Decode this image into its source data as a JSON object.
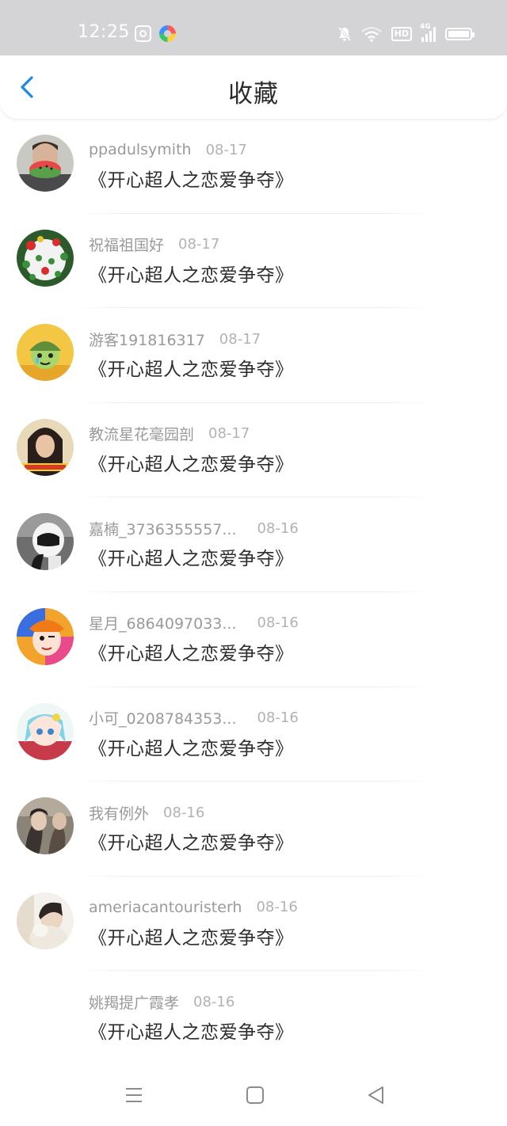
{
  "status_bar": {
    "time": "12:25",
    "signal_label": "4G",
    "hd_label": "HD",
    "icons": [
      "app-icon-1",
      "app-icon-2",
      "mute-bell-icon",
      "wifi-icon",
      "hd-icon",
      "signal-icon",
      "battery-icon"
    ]
  },
  "header": {
    "title": "收藏",
    "back_icon": "chevron-left-icon"
  },
  "favorites": [
    {
      "user": "ppadulsymith",
      "date": "08-17",
      "title": "《开心超人之恋爱争夺》"
    },
    {
      "user": "祝福祖国好",
      "date": "08-17",
      "title": "《开心超人之恋爱争夺》"
    },
    {
      "user": "游客191816317",
      "date": "08-17",
      "title": "《开心超人之恋爱争夺》"
    },
    {
      "user": "教流星花毫园剖",
      "date": "08-17",
      "title": "《开心超人之恋爱争夺》"
    },
    {
      "user": "嘉楠_3736355557...",
      "date": "08-16",
      "title": "《开心超人之恋爱争夺》"
    },
    {
      "user": "星月_6864097033...",
      "date": "08-16",
      "title": "《开心超人之恋爱争夺》"
    },
    {
      "user": "小可_0208784353...",
      "date": "08-16",
      "title": "《开心超人之恋爱争夺》"
    },
    {
      "user": "我有例外",
      "date": "08-16",
      "title": "《开心超人之恋爱争夺》"
    },
    {
      "user": "ameriacantouristerh",
      "date": "08-16",
      "title": "《开心超人之恋爱争夺》"
    },
    {
      "user": "姚羯提广霞孝",
      "date": "08-16",
      "title": "《开心超人之恋爱争夺》"
    }
  ],
  "nav_bar": {
    "icons": [
      "menu-icon",
      "home-square-icon",
      "back-triangle-icon"
    ]
  },
  "colors": {
    "status_bar_bg": "#d4d4d6",
    "accent_blue": "#1e88e5",
    "username_gray": "#9a9a9a",
    "date_gray": "#b2b2b2",
    "title_dark": "#2e2e2e"
  }
}
